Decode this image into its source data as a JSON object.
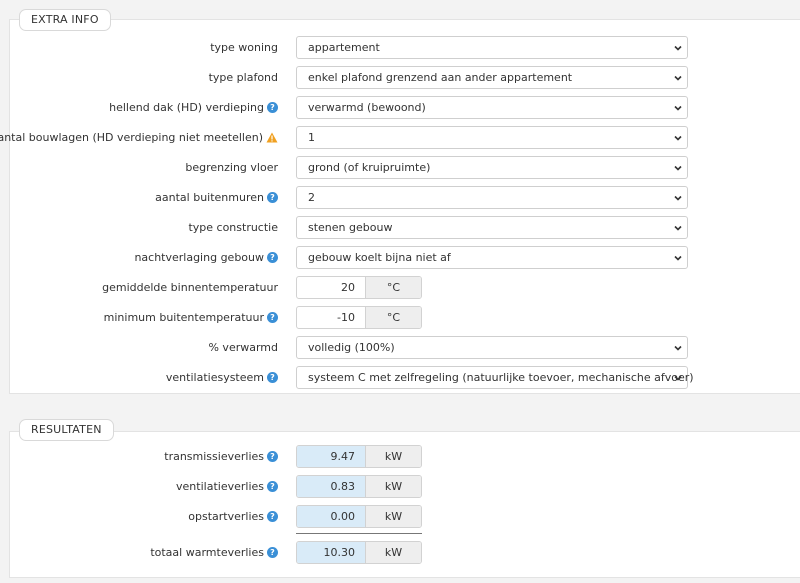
{
  "extra": {
    "legend": "EXTRA INFO",
    "rows": [
      {
        "label": "type woning",
        "value": "appartement"
      },
      {
        "label": "type plafond",
        "value": "enkel plafond grenzend aan ander appartement"
      },
      {
        "label": "hellend dak (HD) verdieping",
        "value": "verwarmd (bewoond)"
      },
      {
        "label": "aantal bouwlagen (HD verdieping niet meetellen)",
        "value": "1"
      },
      {
        "label": "begrenzing vloer",
        "value": "grond (of kruipruimte)"
      },
      {
        "label": "aantal buitenmuren",
        "value": "2"
      },
      {
        "label": "type constructie",
        "value": "stenen gebouw"
      },
      {
        "label": "nachtverlaging gebouw",
        "value": "gebouw koelt bijna niet af"
      },
      {
        "label": "gemiddelde binnentemperatuur",
        "value": "20",
        "unit": "°C"
      },
      {
        "label": "minimum buitentemperatuur",
        "value": "-10",
        "unit": "°C"
      },
      {
        "label": "% verwarmd",
        "value": "volledig (100%)"
      },
      {
        "label": "ventilatiesysteem",
        "value": "systeem C met zelfregeling (natuurlijke toevoer, mechanische afvoer)"
      }
    ]
  },
  "results": {
    "legend": "RESULTATEN",
    "rows": [
      {
        "label": "transmissieverlies",
        "value": "9.47",
        "unit": "kW"
      },
      {
        "label": "ventilatieverlies",
        "value": "0.83",
        "unit": "kW"
      },
      {
        "label": "opstartverlies",
        "value": "0.00",
        "unit": "kW"
      },
      {
        "label": "totaal warmteverlies",
        "value": "10.30",
        "unit": "kW"
      }
    ]
  },
  "icons": {
    "help": "help-icon",
    "warning": "warning-icon",
    "chevron": "chevron-down-icon"
  },
  "colors": {
    "help": "#3a8fd6",
    "warning": "#f0a020",
    "result_bg": "#d9ebf8",
    "unit_bg": "#eeeeee"
  }
}
